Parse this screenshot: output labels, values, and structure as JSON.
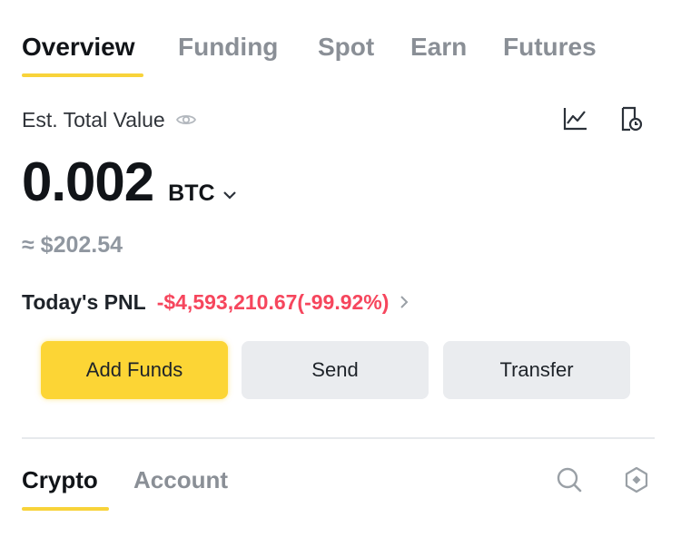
{
  "tabs": [
    {
      "label": "Overview"
    },
    {
      "label": "Funding"
    },
    {
      "label": "Spot"
    },
    {
      "label": "Earn"
    },
    {
      "label": "Futures"
    }
  ],
  "overview": {
    "est_label": "Est. Total Value",
    "balance_value": "0.002",
    "balance_unit": "BTC",
    "approx_value": "≈ $202.54",
    "pnl_label": "Today's PNL",
    "pnl_value": "-$4,593,210.67(-99.92%)"
  },
  "actions": {
    "add_funds": "Add Funds",
    "send": "Send",
    "transfer": "Transfer"
  },
  "sub_tabs": [
    {
      "label": "Crypto"
    },
    {
      "label": "Account"
    }
  ],
  "colors": {
    "accent": "#FCD535",
    "negative": "#F6465D",
    "muted": "#8A8F96"
  },
  "icons": {
    "visibility": "eye-icon",
    "chart": "line-chart-icon",
    "history": "history-icon",
    "search": "search-icon",
    "settings": "hexagon-settings-icon"
  }
}
